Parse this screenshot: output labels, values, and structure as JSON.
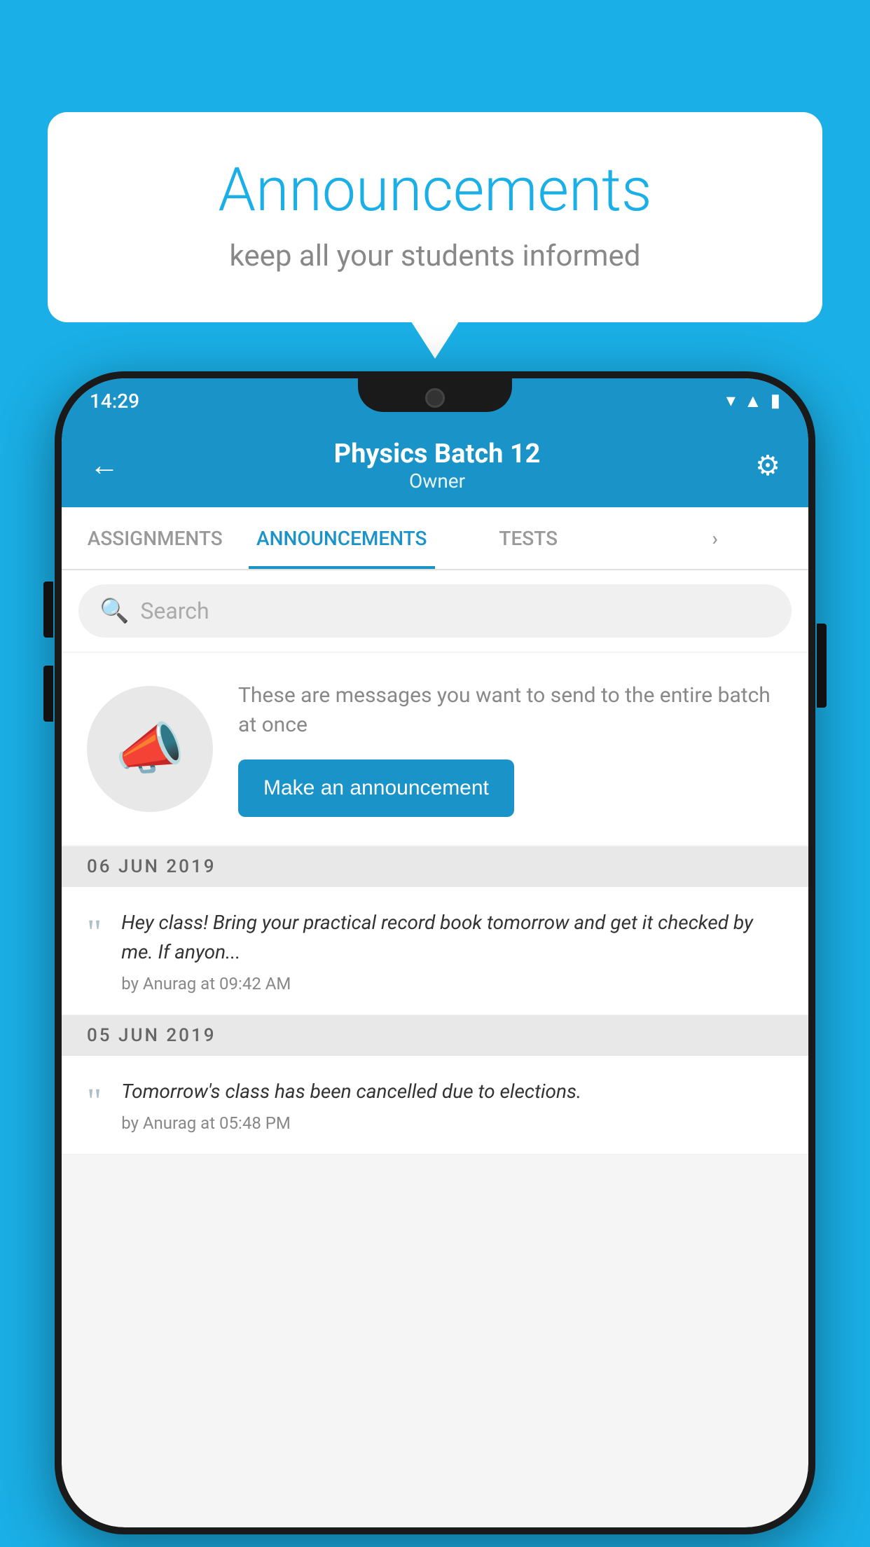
{
  "background_color": "#1AAFE6",
  "speech_bubble": {
    "title": "Announcements",
    "subtitle": "keep all your students informed"
  },
  "phone": {
    "status_bar": {
      "time": "14:29",
      "icons": [
        "wifi",
        "signal",
        "battery"
      ]
    },
    "app_bar": {
      "title": "Physics Batch 12",
      "subtitle": "Owner",
      "back_label": "←",
      "settings_label": "⚙"
    },
    "tabs": [
      {
        "label": "ASSIGNMENTS",
        "active": false
      },
      {
        "label": "ANNOUNCEMENTS",
        "active": true
      },
      {
        "label": "TESTS",
        "active": false
      },
      {
        "label": "·",
        "active": false
      }
    ],
    "search": {
      "placeholder": "Search"
    },
    "announcement_prompt": {
      "description": "These are messages you want to send to the entire batch at once",
      "button_label": "Make an announcement"
    },
    "announcements": [
      {
        "date": "06  JUN  2019",
        "text": "Hey class! Bring your practical record book tomorrow and get it checked by me. If anyon...",
        "meta": "by Anurag at 09:42 AM"
      },
      {
        "date": "05  JUN  2019",
        "text": "Tomorrow's class has been cancelled due to elections.",
        "meta": "by Anurag at 05:48 PM"
      }
    ]
  }
}
